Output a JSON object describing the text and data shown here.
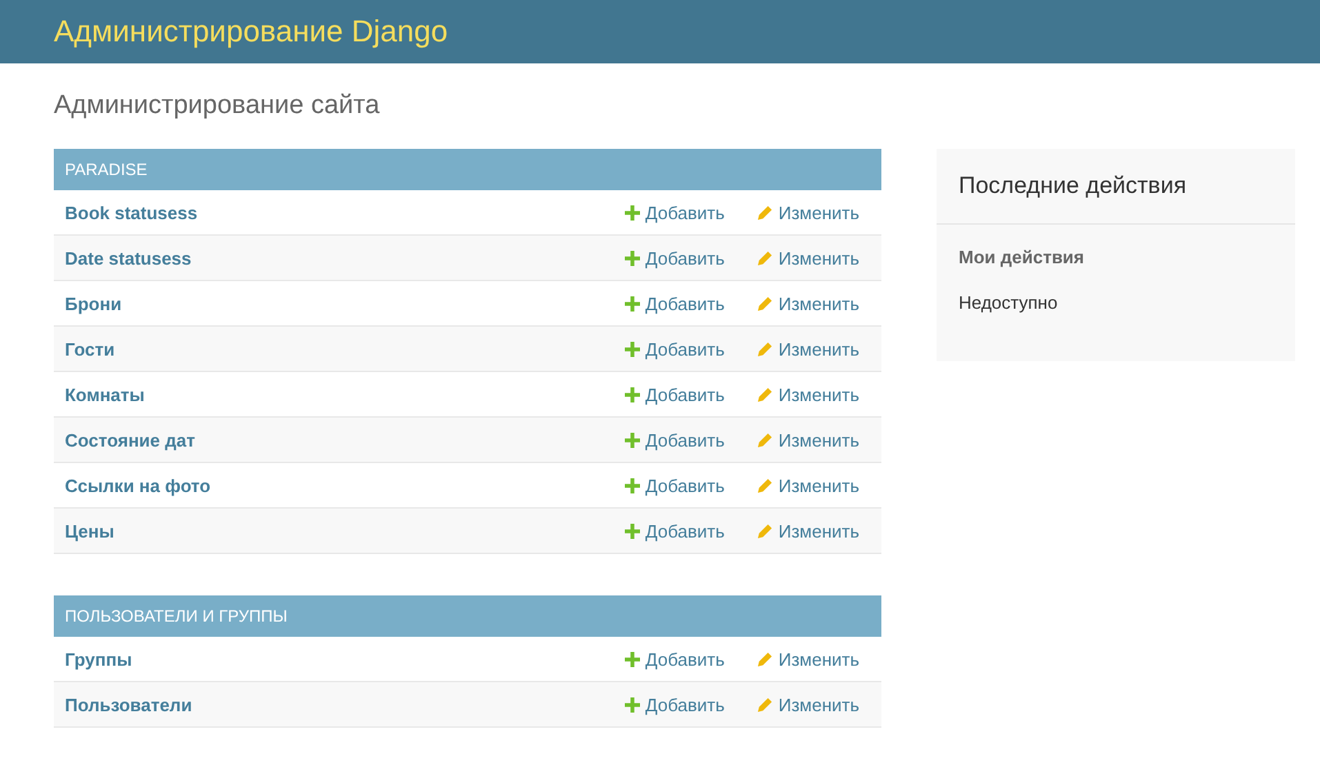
{
  "header": {
    "title": "Администрирование Django"
  },
  "page_title": "Администрирование сайта",
  "modules": [
    {
      "caption": "PARADISE",
      "models": [
        {
          "name": "Book statusess",
          "add": "Добавить",
          "change": "Изменить"
        },
        {
          "name": "Date statusess",
          "add": "Добавить",
          "change": "Изменить"
        },
        {
          "name": "Брони",
          "add": "Добавить",
          "change": "Изменить"
        },
        {
          "name": "Гости",
          "add": "Добавить",
          "change": "Изменить"
        },
        {
          "name": "Комнаты",
          "add": "Добавить",
          "change": "Изменить"
        },
        {
          "name": "Состояние дат",
          "add": "Добавить",
          "change": "Изменить"
        },
        {
          "name": "Ссылки на фото",
          "add": "Добавить",
          "change": "Изменить"
        },
        {
          "name": "Цены",
          "add": "Добавить",
          "change": "Изменить"
        }
      ]
    },
    {
      "caption": "ПОЛЬЗОВАТЕЛИ И ГРУППЫ",
      "models": [
        {
          "name": "Группы",
          "add": "Добавить",
          "change": "Изменить"
        },
        {
          "name": "Пользователи",
          "add": "Добавить",
          "change": "Изменить"
        }
      ]
    }
  ],
  "recent": {
    "title": "Последние действия",
    "subtitle": "Мои действия",
    "text": "Недоступно"
  }
}
